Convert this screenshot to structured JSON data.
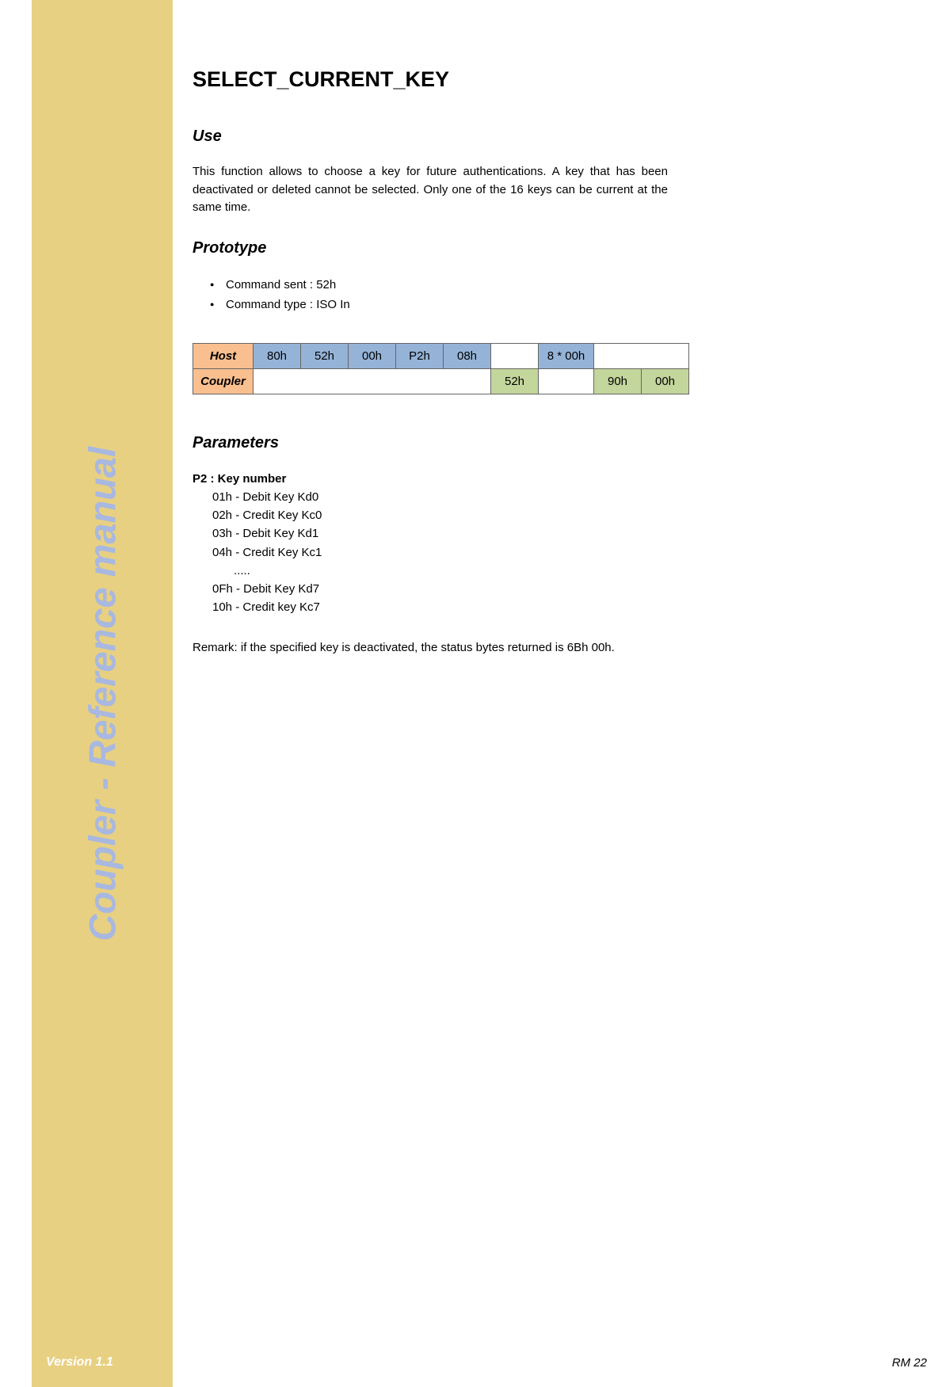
{
  "sidebar": {
    "title": "Coupler - Reference manual",
    "version": "Version 1.1"
  },
  "page": {
    "title": "SELECT_CURRENT_KEY",
    "footer": "RM 22"
  },
  "use": {
    "heading": "Use",
    "text": "This function allows to choose a key for future authentications. A key that has been deactivated or deleted cannot be selected. Only one of the 16 keys can be current at the same time."
  },
  "prototype": {
    "heading": "Prototype",
    "bullets": [
      "Command sent : 52h",
      "Command type : ISO In"
    ],
    "table": {
      "row1": {
        "label": "Host",
        "cells": [
          "80h",
          "52h",
          "00h",
          "P2h",
          "08h",
          "",
          "8 * 00h",
          ""
        ]
      },
      "row2": {
        "label": "Coupler",
        "cells": [
          "",
          "52h",
          "",
          "90h",
          "00h"
        ]
      }
    }
  },
  "parameters": {
    "heading": "Parameters",
    "p2_label": "P2 : Key number",
    "items": [
      "01h - Debit Key Kd0",
      "02h - Credit Key Kc0",
      "03h - Debit Key Kd1",
      "04h - Credit Key Kc1",
      ".....",
      "0Fh - Debit Key Kd7",
      "10h - Credit key Kc7"
    ]
  },
  "remark": {
    "label": "Remark:",
    "text": " if the specified key is deactivated, the status bytes returned is 6Bh 00h."
  }
}
